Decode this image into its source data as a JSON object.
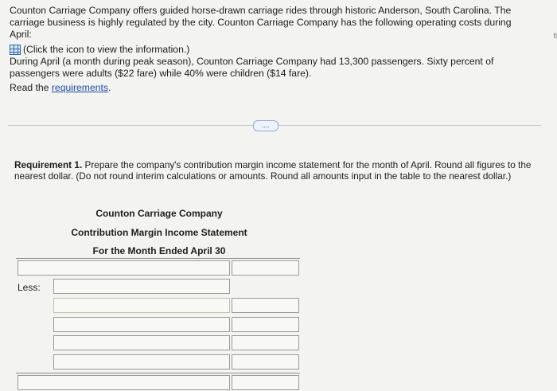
{
  "intro": {
    "para1": "Counton Carriage Company offers guided horse-drawn carriage rides through historic Anderson, South Carolina. The carriage business is highly regulated by the city. Counton Carriage Company has the following operating costs during April:",
    "icon_text": "(Click the icon to view the information.)",
    "para2": "During April (a month during peak season), Counton Carriage Company had 13,300 passengers. Sixty percent of passengers were adults ($22 fare) while 40% were children ($14 fare).",
    "read_prefix": "Read the ",
    "requirements_link": "requirements",
    "read_suffix": "."
  },
  "expander_label": "....",
  "requirement": {
    "label": "Requirement 1.",
    "text": " Prepare the company's contribution margin income statement for the month of April. Round all figures to the nearest dollar. (Do not round interim calculations or amounts. Round all amounts input in the table to the nearest dollar.)"
  },
  "statement": {
    "company": "Counton Carriage Company",
    "title": "Contribution Margin Income Statement",
    "period": "For the Month Ended April 30"
  },
  "less_label": "Less:",
  "edge_fragment": "fi"
}
